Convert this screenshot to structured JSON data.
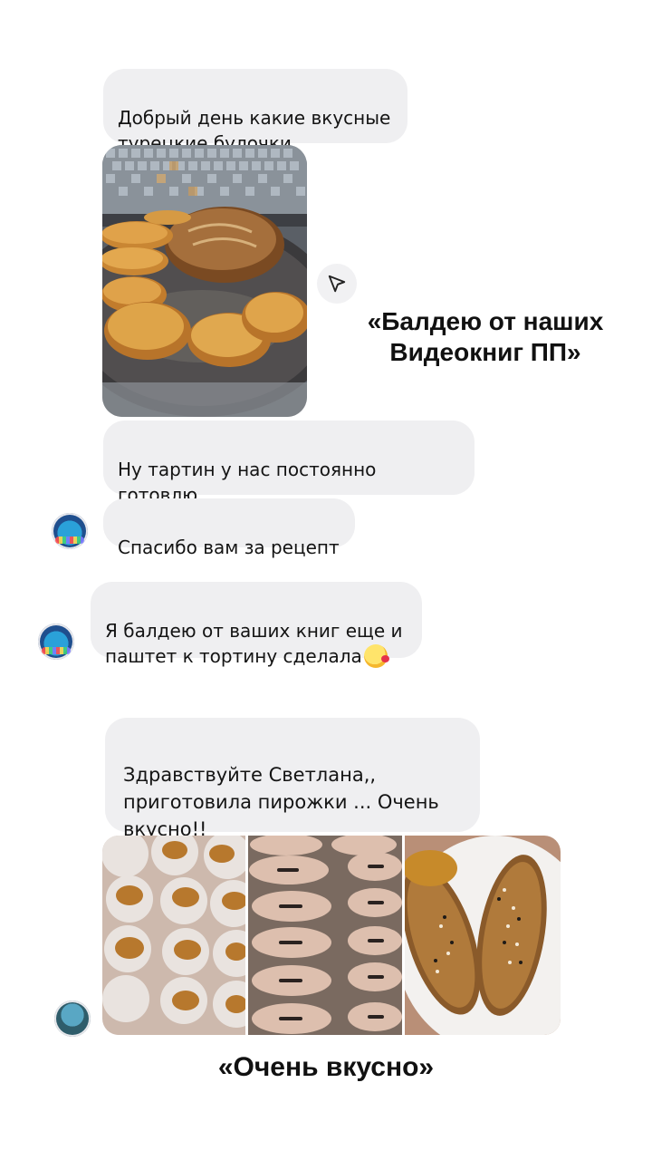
{
  "messages": {
    "m1": "Добрый день какие вкусные\nтурецкие булочки",
    "m2": "Ну тартин у нас постоянно готовлю\nродителям и себе",
    "m3": "Спасибо вам за рецепт",
    "m4": "Я балдею от ваших книг еще и\nпаштет к тортину сделала",
    "m5": "Здравствуйте Светлана,,\nприготовила пирожки ... Очень\nвкусно!!"
  },
  "emoji": {
    "m2": "grinning-face-emoji",
    "m4": "face-blowing-kiss-emoji"
  },
  "captions": {
    "top": "«Балдею от наших\nВидеокниг ПП»",
    "bottom": "«Очень вкусно»"
  },
  "icons": {
    "share": "send-arrow-icon"
  },
  "colors": {
    "bubble": "#efeff1",
    "background": "#ffffff",
    "text": "#141414"
  }
}
